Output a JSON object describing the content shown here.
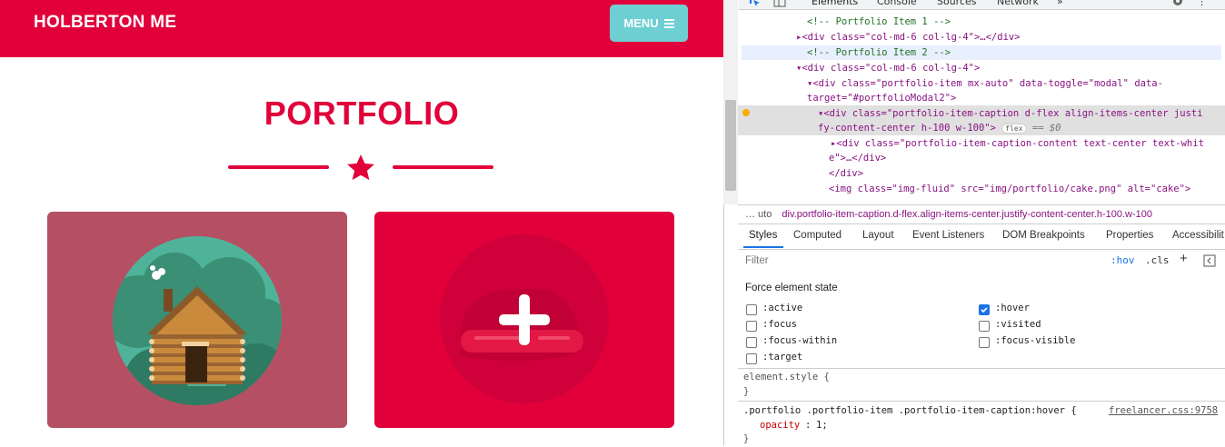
{
  "site": {
    "brand": "HOLBERTON ME",
    "menu_label": "MENU",
    "section_title": "PORTFOLIO",
    "colors": {
      "primary": "#e1003a",
      "menu_button": "#6ecfd3",
      "card1_overlay": "#b54f63"
    },
    "cards": [
      {
        "image_alt": "cabin",
        "icon": "log-cabin-illustration"
      },
      {
        "image_alt": "cake",
        "icon": "plus-icon"
      }
    ]
  },
  "devtools": {
    "tabs": [
      "Elements",
      "Console",
      "Sources",
      "Network",
      "»"
    ],
    "elements": [
      {
        "kind": "comment",
        "text": "<!-- Portfolio Item 1 -->"
      },
      {
        "kind": "node",
        "text": "▸<div class=\"col-md-6 col-lg-4\">…</div>"
      },
      {
        "kind": "comment",
        "text": "<!-- Portfolio Item 2 -->"
      },
      {
        "kind": "node",
        "text": "▾<div class=\"col-md-6 col-lg-4\">"
      },
      {
        "kind": "node",
        "text": "▾<div class=\"portfolio-item mx-auto\" data-toggle=\"modal\" data-"
      },
      {
        "kind": "node",
        "text": "target=\"#portfolioModal2\">"
      },
      {
        "kind": "node",
        "text": "▾<div class=\"portfolio-item-caption d-flex align-items-center justi"
      },
      {
        "kind": "node",
        "text": "fy-content-center h-100 w-100\">"
      },
      {
        "kind": "node",
        "text": "▸<div class=\"portfolio-item-caption-content text-center text-whit"
      },
      {
        "kind": "node",
        "text": "e\">…</div>"
      },
      {
        "kind": "node",
        "text": "</div>"
      },
      {
        "kind": "node",
        "text": "<img class=\"img-fluid\" src=\"img/portfolio/cake.png\" alt=\"cake\">"
      }
    ],
    "flex_badge": "flex",
    "selected_marker": "== $0",
    "breadcrumb_prefix": "… uto",
    "breadcrumb": "div.portfolio-item-caption.d-flex.align-items-center.justify-content-center.h-100.w-100",
    "subtabs": [
      "Styles",
      "Computed",
      "Layout",
      "Event Listeners",
      "DOM Breakpoints",
      "Properties",
      "Accessibilit"
    ],
    "filter_placeholder": "Filter",
    "hov": ":hov",
    "cls": ".cls",
    "force_state_title": "Force element state",
    "states_left": [
      {
        "label": ":active",
        "checked": false
      },
      {
        "label": ":focus",
        "checked": false
      },
      {
        "label": ":focus-within",
        "checked": false
      },
      {
        "label": ":target",
        "checked": false
      }
    ],
    "states_right": [
      {
        "label": ":hover",
        "checked": true
      },
      {
        "label": ":visited",
        "checked": false
      },
      {
        "label": ":focus-visible",
        "checked": false
      }
    ],
    "element_style": "element.style {",
    "close_brace": "}",
    "rule_selector": ".portfolio .portfolio-item .portfolio-item-caption:hover {",
    "rule_source": "freelancer.css:9758",
    "rule_prop": "opacity",
    "rule_value": "1;"
  }
}
